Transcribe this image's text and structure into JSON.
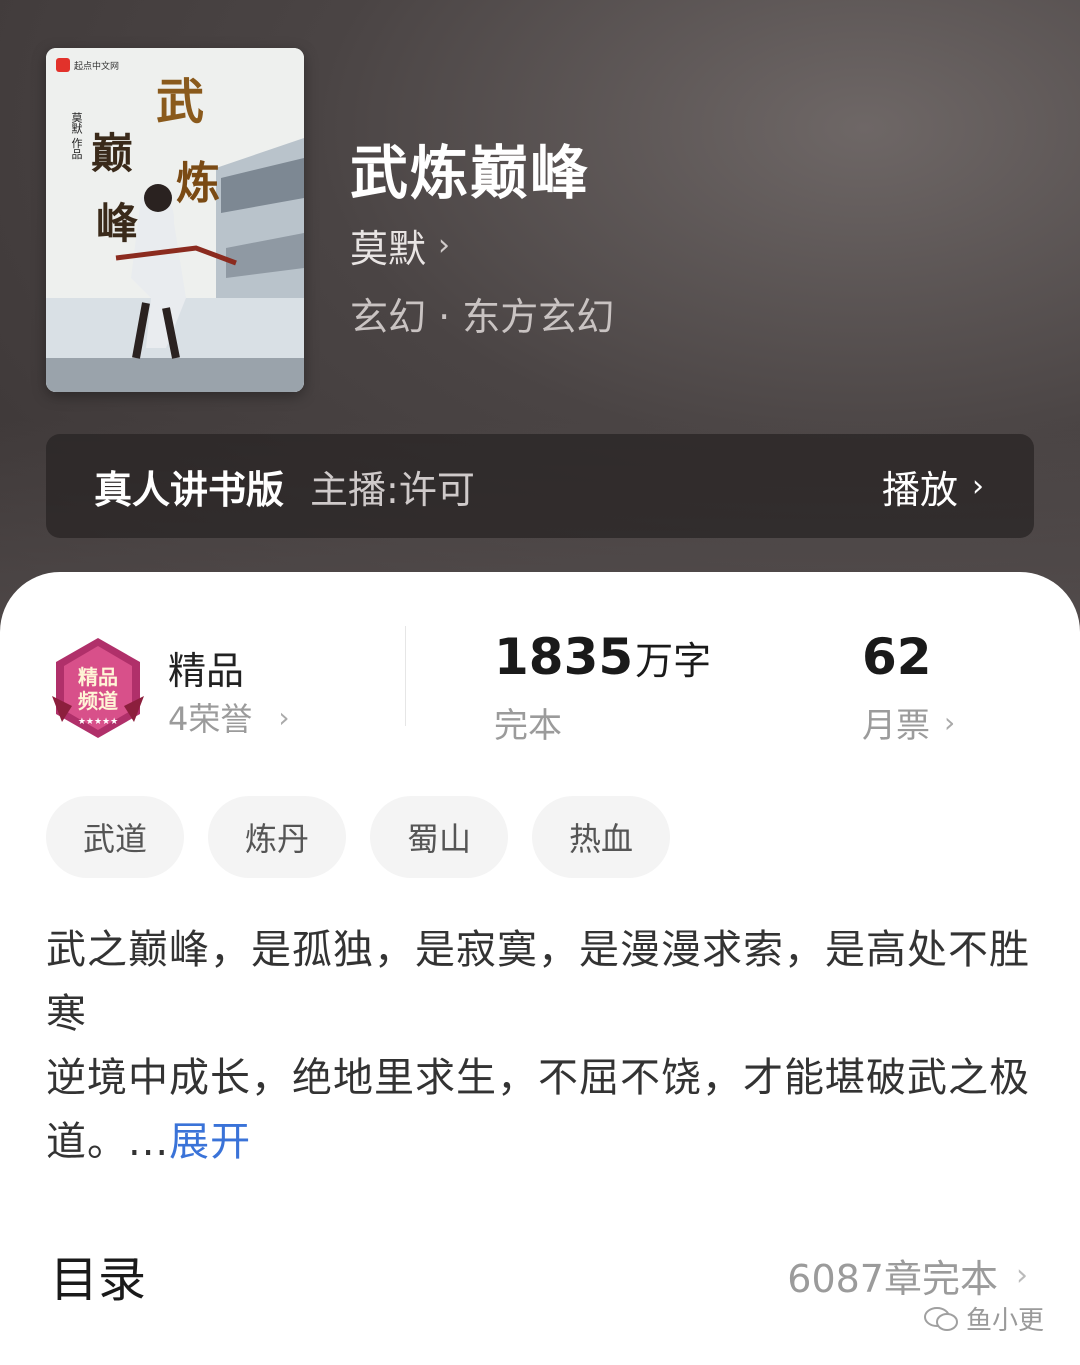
{
  "book": {
    "title": "武炼巅峰",
    "author": "莫默",
    "genre": "玄幻 · 东方玄幻",
    "cover_publisher": "起点中文网",
    "cover_author": "莫默 作品"
  },
  "audio": {
    "title": "真人讲书版",
    "host": "主播:许可",
    "play_label": "播放"
  },
  "stats": {
    "badge_title": "精品",
    "badge_sub": "4荣誉",
    "word_count": "1835",
    "word_unit": "万字",
    "status": "完本",
    "monthly_votes": "62",
    "votes_label": "月票"
  },
  "tags": [
    "武道",
    "炼丹",
    "蜀山",
    "热血"
  ],
  "description": {
    "text": "武之巅峰，是孤独，是寂寞，是漫漫求索，是高处不胜寒\n逆境中成长，绝地里求生，不屈不饶，才能堪破武之极道。...",
    "expand": "展开"
  },
  "toc": {
    "title": "目录",
    "info": "6087章完本"
  },
  "watermark": "鱼小更",
  "colors": {
    "link": "#3a73d8",
    "badge": "#b0306a"
  }
}
